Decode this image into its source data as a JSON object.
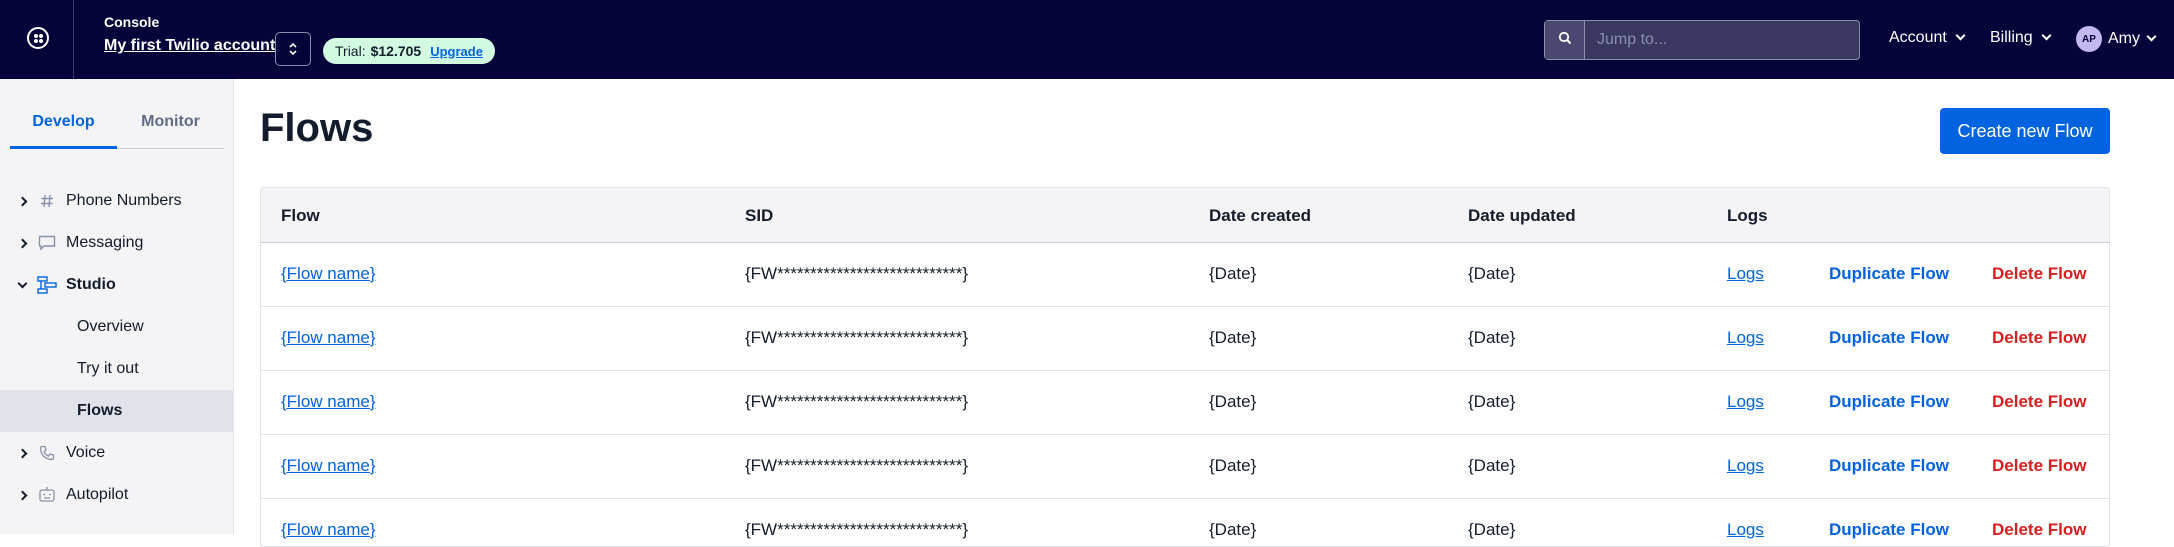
{
  "topbar": {
    "console_label": "Console",
    "account_name": "My first Twilio account",
    "trial": {
      "label": "Trial:",
      "balance": "$12.705",
      "upgrade": "Upgrade"
    },
    "search": {
      "placeholder": "Jump to..."
    },
    "menu": {
      "account": "Account",
      "billing": "Billing",
      "user_initials": "AP",
      "user_name": "Amy"
    }
  },
  "sidebar": {
    "tabs": [
      "Develop",
      "Monitor"
    ],
    "active_tab": "Develop",
    "items": [
      {
        "label": "Phone Numbers",
        "icon": "hash-icon"
      },
      {
        "label": "Messaging",
        "icon": "chat-bubble-icon"
      },
      {
        "label": "Studio",
        "icon": "studio-flow-icon",
        "expanded": true,
        "children": [
          "Overview",
          "Try it out",
          "Flows"
        ]
      },
      {
        "label": "Voice",
        "icon": "phone-icon"
      },
      {
        "label": "Autopilot",
        "icon": "robot-icon"
      }
    ],
    "selected_child": "Flows"
  },
  "main": {
    "title": "Flows",
    "create_button": "Create new Flow",
    "table": {
      "headers": [
        "Flow",
        "SID",
        "Date created",
        "Date updated",
        "Logs"
      ],
      "rows": [
        {
          "flow": "{Flow name}",
          "sid": "{FW****************************}",
          "created": "{Date}",
          "updated": "{Date}",
          "logs": "Logs",
          "duplicate": "Duplicate Flow",
          "delete": "Delete Flow"
        },
        {
          "flow": "{Flow name}",
          "sid": "{FW****************************}",
          "created": "{Date}",
          "updated": "{Date}",
          "logs": "Logs",
          "duplicate": "Duplicate Flow",
          "delete": "Delete Flow"
        },
        {
          "flow": "{Flow name}",
          "sid": "{FW****************************}",
          "created": "{Date}",
          "updated": "{Date}",
          "logs": "Logs",
          "duplicate": "Duplicate Flow",
          "delete": "Delete Flow"
        },
        {
          "flow": "{Flow name}",
          "sid": "{FW****************************}",
          "created": "{Date}",
          "updated": "{Date}",
          "logs": "Logs",
          "duplicate": "Duplicate Flow",
          "delete": "Delete Flow"
        },
        {
          "flow": "{Flow name}",
          "sid": "{FW****************************}",
          "created": "{Date}",
          "updated": "{Date}",
          "logs": "Logs",
          "duplicate": "Duplicate Flow",
          "delete": "Delete Flow"
        }
      ]
    }
  },
  "colors": {
    "topbar_bg": "#06033a",
    "primary": "#0263e0",
    "danger": "#d61f1f",
    "trial_pill": "#d1fae0"
  }
}
